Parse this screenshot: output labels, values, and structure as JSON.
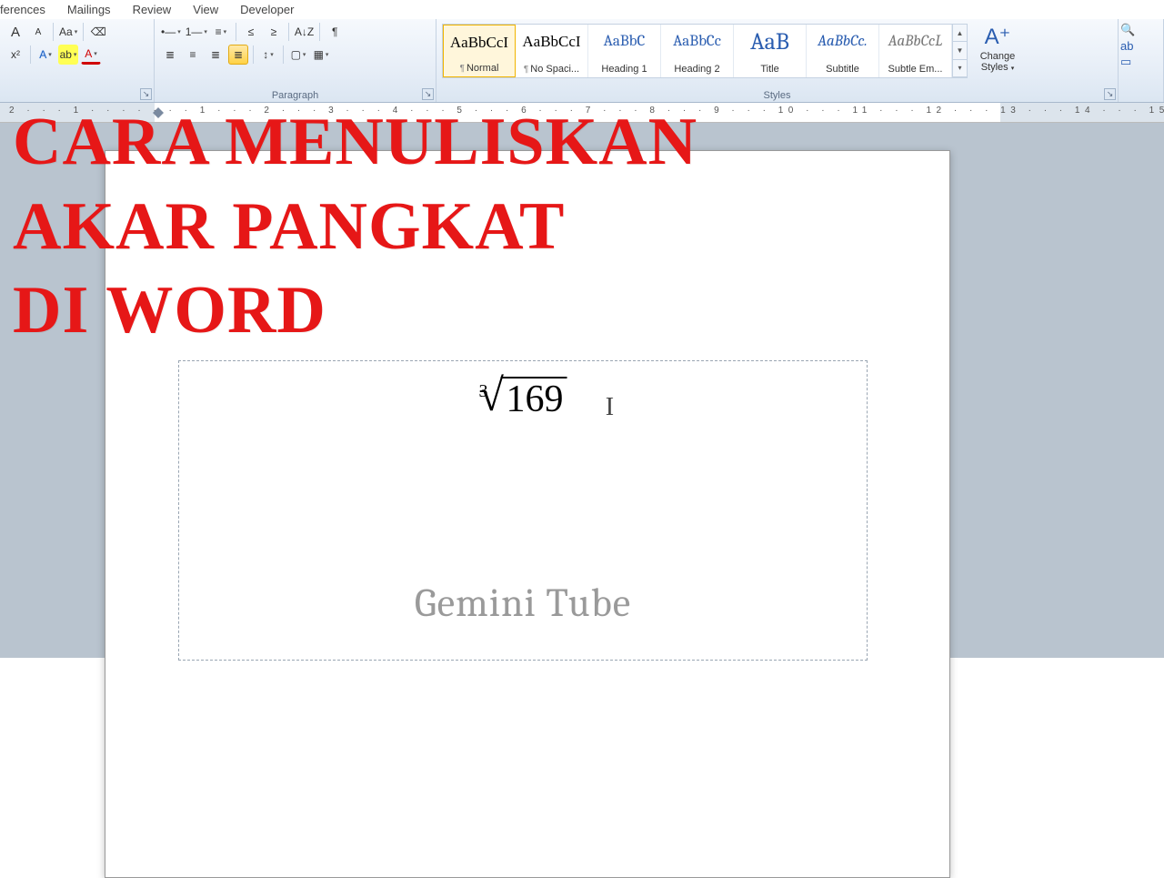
{
  "menu": {
    "items": [
      "ferences",
      "Mailings",
      "Review",
      "View",
      "Developer"
    ]
  },
  "font_group": {
    "grow": "A",
    "shrink": "A",
    "case": "Aa",
    "clear": "⌫",
    "effects": "A",
    "highlight": "ab",
    "fontcolor": "A",
    "superscript": "x²"
  },
  "para_group": {
    "label": "Paragraph",
    "bullets": "•—",
    "numbers": "1—",
    "multi": "≡",
    "dec": "≤",
    "inc": "≥",
    "sort": "A↓Z",
    "marks": "¶",
    "left": "≣",
    "center": "≡",
    "right": "≣",
    "just": "≣",
    "spacing": "↕",
    "shade": "▢",
    "border": "▦"
  },
  "styles": {
    "label": "Styles",
    "items": [
      {
        "preview": "AaBbCcI",
        "name": "¶ Normal",
        "cls": "",
        "sel": true
      },
      {
        "preview": "AaBbCcI",
        "name": "¶ No Spaci...",
        "cls": ""
      },
      {
        "preview": "AaBbC",
        "name": "Heading 1",
        "cls": "blue"
      },
      {
        "preview": "AaBbCc",
        "name": "Heading 2",
        "cls": "blue"
      },
      {
        "preview": "AaB",
        "name": "Title",
        "cls": "bluebig"
      },
      {
        "preview": "AaBbCc.",
        "name": "Subtitle",
        "cls": "ital"
      },
      {
        "preview": "AaBbCcL",
        "name": "Subtle Em...",
        "cls": "gray"
      }
    ],
    "change": "Change\nStyles"
  },
  "editing": {
    "find": "🔍",
    "replace": "ab",
    "select": "▭"
  },
  "equation": {
    "degree": "3",
    "radicand": "169"
  },
  "watermark": "Gemini Tube",
  "overlay": {
    "l1": "CARA MENULISKAN",
    "l2": "AKAR PANGKAT",
    "l3": "DI WORD"
  }
}
